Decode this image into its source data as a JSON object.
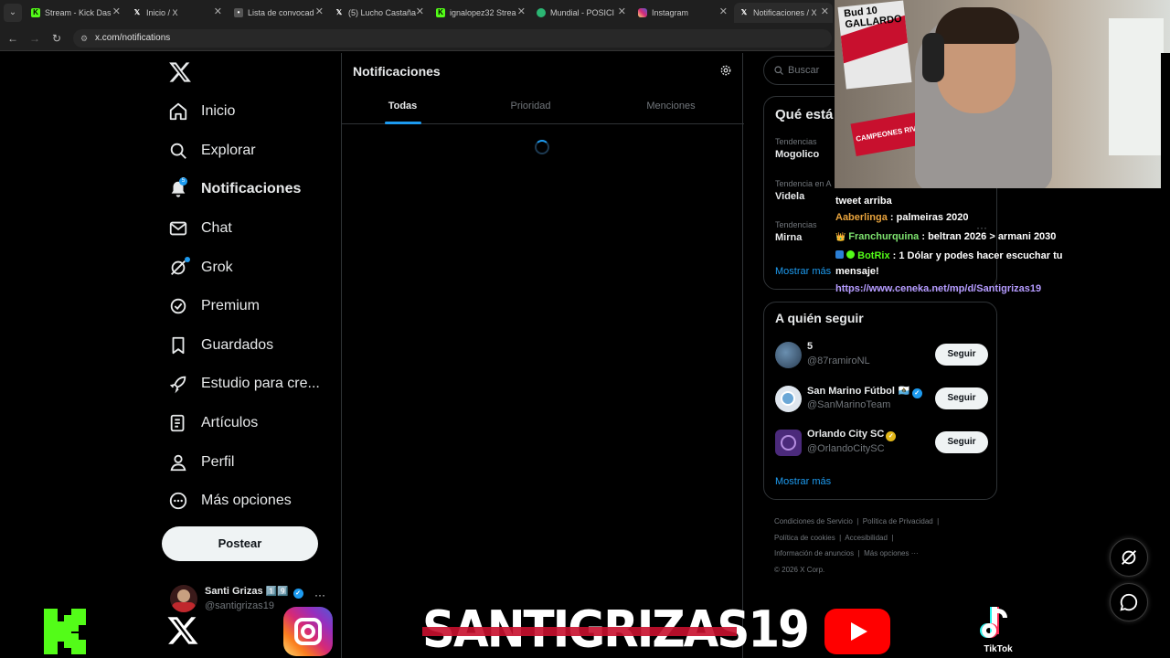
{
  "browser": {
    "tabs": [
      {
        "label": "Stream - Kick Das",
        "icon": "kick-favicon",
        "color": "#53fc18"
      },
      {
        "label": "Inicio / X",
        "icon": "x-favicon",
        "color": "#ffffff"
      },
      {
        "label": "Lista de convocad",
        "icon": "site-favicon",
        "color": "#888888"
      },
      {
        "label": "(5) Lucho Castaña",
        "icon": "x-favicon",
        "color": "#ffffff"
      },
      {
        "label": "ignalopez32 Strea",
        "icon": "kick-favicon",
        "color": "#53fc18"
      },
      {
        "label": "Mundial - POSICI",
        "icon": "shield-favicon",
        "color": "#2bb673"
      },
      {
        "label": "Instagram",
        "icon": "instagram-favicon",
        "color": "#e1306c"
      },
      {
        "label": "Notificaciones / X",
        "icon": "x-favicon",
        "color": "#ffffff"
      }
    ],
    "url": "x.com/notifications"
  },
  "sidebar": {
    "items": [
      {
        "label": "Inicio",
        "icon": "home-icon"
      },
      {
        "label": "Explorar",
        "icon": "search-icon"
      },
      {
        "label": "Notificaciones",
        "icon": "bell-icon",
        "badge": "5"
      },
      {
        "label": "Chat",
        "icon": "mail-icon"
      },
      {
        "label": "Grok",
        "icon": "grok-icon"
      },
      {
        "label": "Premium",
        "icon": "premium-icon"
      },
      {
        "label": "Guardados",
        "icon": "bookmark-icon"
      },
      {
        "label": "Estudio para cre...",
        "icon": "rocket-icon"
      },
      {
        "label": "Artículos",
        "icon": "article-icon"
      },
      {
        "label": "Perfil",
        "icon": "person-icon"
      },
      {
        "label": "Más opciones",
        "icon": "more-circle-icon"
      }
    ],
    "post_button": "Postear",
    "profile": {
      "name": "Santi Grizas",
      "badges": "1️⃣9️⃣",
      "handle": "@santigrizas19",
      "more": "···"
    }
  },
  "main": {
    "title": "Notificaciones",
    "tabs": [
      "Todas",
      "Prioridad",
      "Menciones"
    ],
    "active_tab": "Todas"
  },
  "right": {
    "search_placeholder": "Buscar",
    "trends_title": "Qué está",
    "trends": [
      {
        "context": "Tendencias",
        "name": "Mogolico"
      },
      {
        "context": "Tendencia en A",
        "name": "Videla"
      },
      {
        "context": "Tendencias",
        "name": "Mirna"
      }
    ],
    "trend_more": "···",
    "show_more_trends": "Mostrar más",
    "follow_title": "A quién seguir",
    "follow": [
      {
        "name": "5",
        "handle": "@87ramiroNL",
        "button": "Seguir",
        "verified": ""
      },
      {
        "name": "San Marino Fútbol",
        "flag": "🇸🇲",
        "handle": "@SanMarinoTeam",
        "button": "Seguir",
        "verified": "blue"
      },
      {
        "name": "Orlando City SC",
        "handle": "@OrlandoCitySC",
        "button": "Seguir",
        "verified": "gold"
      }
    ],
    "show_more_follow": "Mostrar más",
    "footer": {
      "terms": "Condiciones de Servicio",
      "privacy": "Política de Privacidad",
      "cookies": "Política de cookies",
      "accessibility": "Accesibilidad",
      "ads": "Información de anuncios",
      "more": "Más opciones ···",
      "copyright": "© 2026 X Corp."
    }
  },
  "stream": {
    "chat": [
      {
        "user": "",
        "text": "tweet arriba"
      },
      {
        "user": "Aaberlinga",
        "user_color": "#e8a33d",
        "text": ": palmeiras 2020"
      },
      {
        "user": "Franchurquina",
        "user_color": "#7ee36f",
        "text": ": beltran 2026 > armani 2030",
        "badge": "👑"
      },
      {
        "user": "BotRix",
        "user_color": "#53fc18",
        "text": ": 1 Dólar y podes hacer escuchar tu mensaje!"
      },
      {
        "user": "",
        "link": "https://www.ceneka.net/mp/d/Santigrizas19"
      }
    ],
    "channel_name": "SANTIGRIZAS19",
    "tiktok_label": "TikTok",
    "webcam_banner": "CAMPEONES RIVER",
    "jersey_text": "Bud 10 GALLARDO"
  },
  "colors": {
    "accent": "#1d9bf0",
    "background": "#000000",
    "text": "#e7e9ea",
    "muted": "#71767b",
    "border": "#2f3336"
  }
}
